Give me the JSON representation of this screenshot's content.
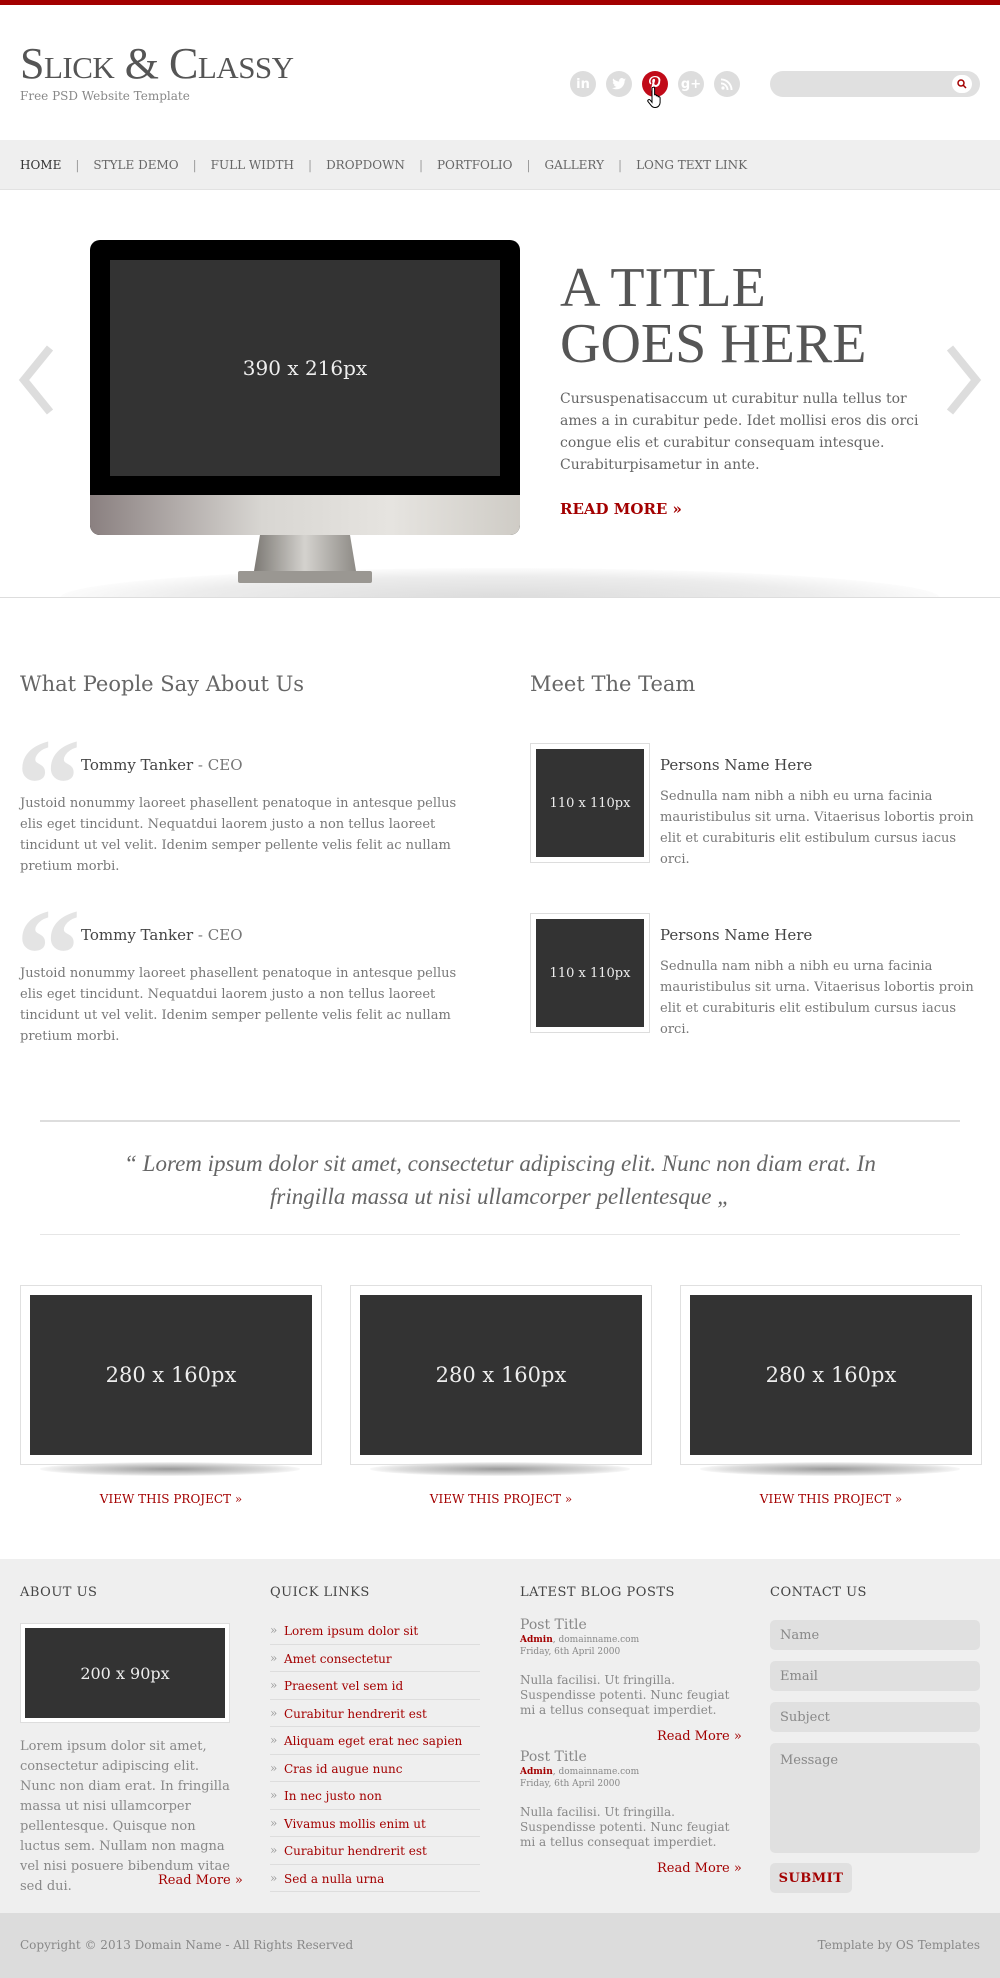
{
  "header": {
    "logo": "Slick & Classy",
    "tagline": "Free PSD Website Template",
    "social": [
      "linkedin-icon",
      "twitter-icon",
      "pinterest-icon",
      "google-plus-icon",
      "rss-icon"
    ],
    "search_placeholder": ""
  },
  "nav": [
    "HOME",
    "STYLE DEMO",
    "FULL WIDTH",
    "DROPDOWN",
    "PORTFOLIO",
    "GALLERY",
    "LONG TEXT LINK"
  ],
  "slider": {
    "image_label": "390 x 216px",
    "title_line1": "A TITLE",
    "title_line2": "GOES HERE",
    "text": "Cursuspenatisaccum ut curabitur nulla tellus tor ames a in curabitur pede. Idet mollisi eros dis orci congue elis et curabitur consequam intesque. Curabiturpisametur in ante.",
    "read_more": "READ MORE »"
  },
  "testimonials": {
    "title": "What People Say About Us",
    "items": [
      {
        "name": "Tommy Tanker",
        "role": " - CEO",
        "text": "Justoid nonummy laoreet phasellent penatoque in antesque pellus elis eget tincidunt. Nequatdui laorem justo a non tellus laoreet tincidunt ut vel velit. Idenim semper pellente velis felit ac nullam pretium morbi."
      },
      {
        "name": "Tommy Tanker",
        "role": " - CEO",
        "text": "Justoid nonummy laoreet phasellent penatoque in antesque pellus elis eget tincidunt. Nequatdui laorem justo a non tellus laoreet tincidunt ut vel velit. Idenim semper pellente velis felit ac nullam pretium morbi."
      }
    ]
  },
  "team": {
    "title": "Meet The Team",
    "items": [
      {
        "photo": "110 x 110px",
        "name": "Persons Name Here",
        "text": "Sednulla nam nibh a nibh eu urna facinia mauristibulus sit urna. Vitaerisus lobortis proin elit et curabituris elit estibulum cursus iacus orci."
      },
      {
        "photo": "110 x 110px",
        "name": "Persons Name Here",
        "text": "Sednulla nam nibh a nibh eu urna facinia mauristibulus sit urna. Vitaerisus lobortis proin elit et curabituris elit estibulum cursus iacus orci."
      }
    ]
  },
  "big_quote": "“ Lorem ipsum dolor sit amet, consectetur adipiscing elit. Nunc non diam erat. In fringilla massa ut nisi ullamcorper pellentesque „",
  "projects": [
    {
      "image": "280 x 160px",
      "link": "VIEW THIS PROJECT »"
    },
    {
      "image": "280 x 160px",
      "link": "VIEW THIS PROJECT »"
    },
    {
      "image": "280 x 160px",
      "link": "VIEW THIS PROJECT »"
    }
  ],
  "footer": {
    "about": {
      "title": "ABOUT US",
      "image": "200 x 90px",
      "text": "Lorem ipsum dolor sit amet, consectetur adipiscing elit. Nunc non diam erat. In fringilla massa ut nisi ullamcorper pellentesque. Quisque non luctus sem. Nullam non magna vel nisi posuere bibendum vitae sed dui.",
      "read_more": "Read More »"
    },
    "quick_links": {
      "title": "QUICK LINKS",
      "items": [
        "Lorem ipsum dolor sit",
        "Amet consectetur",
        "Praesent vel sem id",
        "Curabitur hendrerit est",
        "Aliquam eget erat nec sapien",
        "Cras id augue nunc",
        "In nec justo non",
        "Vivamus mollis enim ut",
        "Curabitur hendrerit est",
        "Sed a nulla urna"
      ]
    },
    "blog": {
      "title": "LATEST BLOG POSTS",
      "posts": [
        {
          "title": "Post Title",
          "author": "Admin",
          "site": ", domainname.com",
          "date": "Friday, 6th April 2000",
          "text": "Nulla facilisi. Ut fringilla. Suspendisse potenti. Nunc feugiat mi a tellus consequat imperdiet.",
          "read_more": "Read More »"
        },
        {
          "title": "Post Title",
          "author": "Admin",
          "site": ", domainname.com",
          "date": "Friday, 6th April 2000",
          "text": "Nulla facilisi. Ut fringilla. Suspendisse potenti. Nunc feugiat mi a tellus consequat imperdiet.",
          "read_more": "Read More »"
        }
      ]
    },
    "contact": {
      "title": "CONTACT US",
      "name_placeholder": "Name",
      "email_placeholder": "Email",
      "subject_placeholder": "Subject",
      "message_placeholder": "Message",
      "submit": "SUBMIT"
    }
  },
  "bottom": {
    "copyright": "Copyright © 2013 Domain Name - All Rights Reserved",
    "credit": "Template by OS Templates"
  },
  "colors": {
    "accent": "#a30000",
    "pinterest": "#c10b19"
  }
}
